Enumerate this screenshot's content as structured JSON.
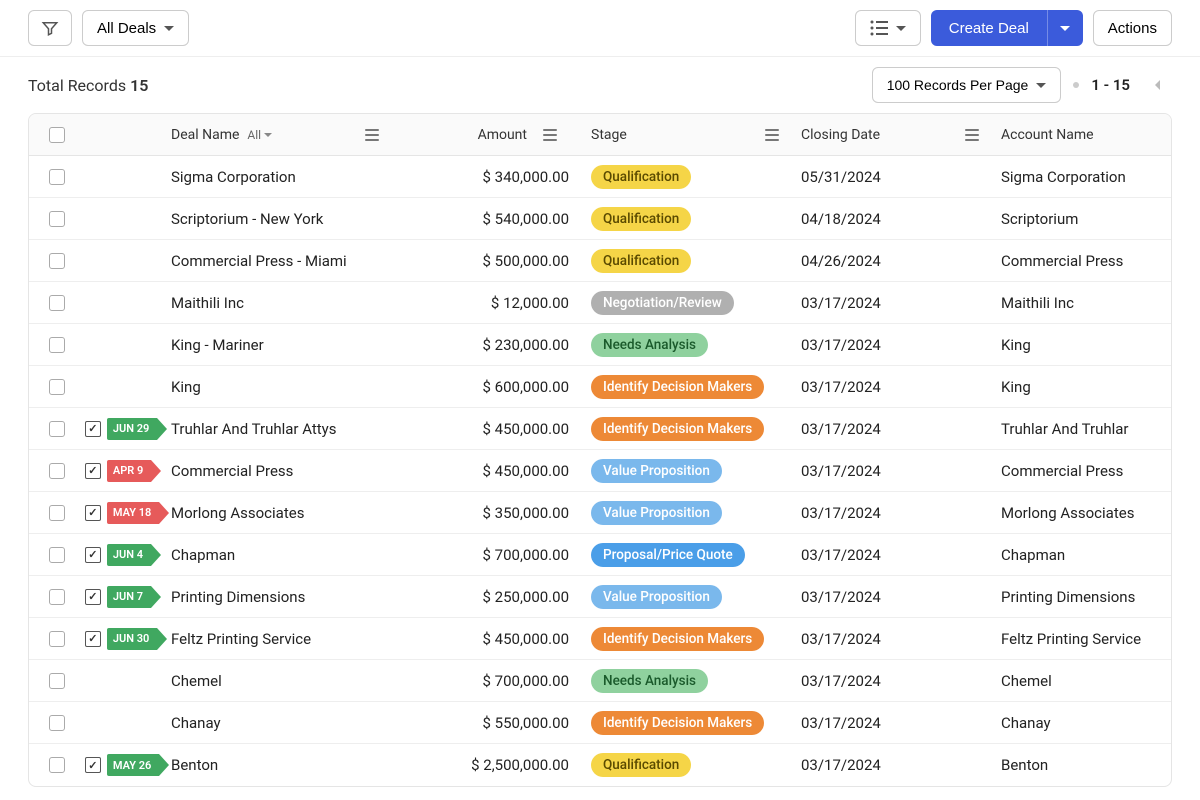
{
  "toolbar": {
    "filter_label": "All Deals",
    "create_label": "Create Deal",
    "actions_label": "Actions"
  },
  "subbar": {
    "records_text": "Total Records",
    "records_count": "15",
    "per_page_label": "100 Records Per Page",
    "range_text": "1 - 15"
  },
  "columns": {
    "deal_name": "Deal Name",
    "deal_name_filter": "All",
    "amount": "Amount",
    "stage": "Stage",
    "closing_date": "Closing Date",
    "account_name": "Account Name"
  },
  "stage_colors": {
    "Qualification": {
      "bg": "#f5d547",
      "fg": "#5a4a00"
    },
    "Negotiation/Review": {
      "bg": "#b0b0b0",
      "fg": "#fff"
    },
    "Needs Analysis": {
      "bg": "#8fd19e",
      "fg": "#1a5a2b"
    },
    "Identify Decision Makers": {
      "bg": "#ed8936",
      "fg": "#fff"
    },
    "Value Proposition": {
      "bg": "#7ab8ec",
      "fg": "#fff"
    },
    "Proposal/Price Quote": {
      "bg": "#4a9ee8",
      "fg": "#fff"
    }
  },
  "rows": [
    {
      "name": "Sigma Corporation",
      "amount": "$ 340,000.00",
      "stage": "Qualification",
      "date": "05/31/2024",
      "account": "Sigma Corporation",
      "tag": null
    },
    {
      "name": "Scriptorium - New York",
      "amount": "$ 540,000.00",
      "stage": "Qualification",
      "date": "04/18/2024",
      "account": "Scriptorium",
      "tag": null
    },
    {
      "name": "Commercial Press - Miami",
      "amount": "$ 500,000.00",
      "stage": "Qualification",
      "date": "04/26/2024",
      "account": "Commercial Press",
      "tag": null
    },
    {
      "name": "Maithili Inc",
      "amount": "$ 12,000.00",
      "stage": "Negotiation/Review",
      "date": "03/17/2024",
      "account": "Maithili Inc",
      "tag": null
    },
    {
      "name": "King - Mariner",
      "amount": "$ 230,000.00",
      "stage": "Needs Analysis",
      "date": "03/17/2024",
      "account": "King",
      "tag": null
    },
    {
      "name": "King",
      "amount": "$ 600,000.00",
      "stage": "Identify Decision Makers",
      "date": "03/17/2024",
      "account": "King",
      "tag": null
    },
    {
      "name": "Truhlar And Truhlar Attys",
      "amount": "$ 450,000.00",
      "stage": "Identify Decision Makers",
      "date": "03/17/2024",
      "account": "Truhlar And Truhlar",
      "tag": {
        "text": "JUN 29",
        "color": "green"
      }
    },
    {
      "name": "Commercial Press",
      "amount": "$ 450,000.00",
      "stage": "Value Proposition",
      "date": "03/17/2024",
      "account": "Commercial Press",
      "tag": {
        "text": "APR 9",
        "color": "red"
      }
    },
    {
      "name": "Morlong Associates",
      "amount": "$ 350,000.00",
      "stage": "Value Proposition",
      "date": "03/17/2024",
      "account": "Morlong Associates",
      "tag": {
        "text": "MAY 18",
        "color": "red"
      }
    },
    {
      "name": "Chapman",
      "amount": "$ 700,000.00",
      "stage": "Proposal/Price Quote",
      "date": "03/17/2024",
      "account": "Chapman",
      "tag": {
        "text": "JUN 4",
        "color": "green"
      }
    },
    {
      "name": "Printing Dimensions",
      "amount": "$ 250,000.00",
      "stage": "Value Proposition",
      "date": "03/17/2024",
      "account": "Printing Dimensions",
      "tag": {
        "text": "JUN 7",
        "color": "green"
      }
    },
    {
      "name": "Feltz Printing Service",
      "amount": "$ 450,000.00",
      "stage": "Identify Decision Makers",
      "date": "03/17/2024",
      "account": "Feltz Printing Service",
      "tag": {
        "text": "JUN 30",
        "color": "green"
      }
    },
    {
      "name": "Chemel",
      "amount": "$ 700,000.00",
      "stage": "Needs Analysis",
      "date": "03/17/2024",
      "account": "Chemel",
      "tag": null
    },
    {
      "name": "Chanay",
      "amount": "$ 550,000.00",
      "stage": "Identify Decision Makers",
      "date": "03/17/2024",
      "account": "Chanay",
      "tag": null
    },
    {
      "name": "Benton",
      "amount": "$ 2,500,000.00",
      "stage": "Qualification",
      "date": "03/17/2024",
      "account": "Benton",
      "tag": {
        "text": "MAY 26",
        "color": "green"
      }
    }
  ]
}
